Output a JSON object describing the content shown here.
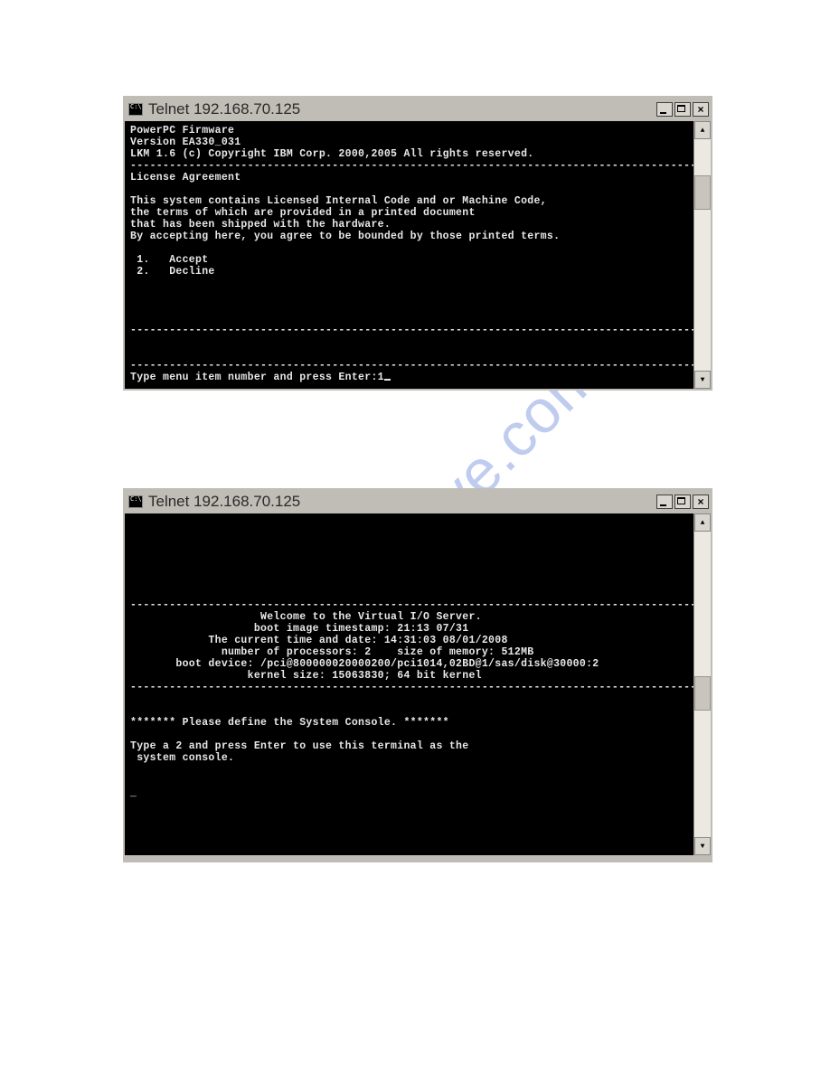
{
  "watermark": "manualshive.com",
  "window1": {
    "title": "Telnet 192.168.70.125",
    "icon_label": "C:\\",
    "lines": {
      "l0": "PowerPC Firmware",
      "l1": "Version EA330_031",
      "l2": "LKM 1.6 (c) Copyright IBM Corp. 2000,2005 All rights reserved.",
      "hr1": "-------------------------------------------------------------------------------------------------",
      "l3": "License Agreement",
      "blank1": "",
      "l4": "This system contains Licensed Internal Code and or Machine Code,",
      "l5": "the terms of which are provided in a printed document",
      "l6": "that has been shipped with the hardware.",
      "l7": "By accepting here, you agree to be bounded by those printed terms.",
      "blank2": "",
      "opt1": " 1.   Accept",
      "opt2": " 2.   Decline",
      "blank3": "",
      "blank4": "",
      "blank5": "",
      "blank6": "",
      "hr2": "-------------------------------------------------------------------------------------------------",
      "blank7": "",
      "blank8": "",
      "hr3": "-------------------------------------------------------------------------------------------------",
      "prompt": "Type menu item number and press Enter:1"
    }
  },
  "window2": {
    "title": "Telnet 192.168.70.125",
    "icon_label": "C:\\",
    "lines": {
      "blank_top": "\n\n\n\n\n\n",
      "hr1": "-------------------------------------------------------------------------------------------------",
      "c1": "                    Welcome to the Virtual I/O Server.",
      "c2": "                   boot image timestamp: 21:13 07/31",
      "c3": "            The current time and date: 14:31:03 08/01/2008",
      "c4": "              number of processors: 2    size of memory: 512MB",
      "c5": "       boot device: /pci@800000020000200/pci1014,02BD@1/sas/disk@30000:2",
      "c6": "                  kernel size: 15063830; 64 bit kernel",
      "hr2": "-------------------------------------------------------------------------------------------------",
      "blank1": "",
      "blank2": "",
      "p1": "******* Please define the System Console. *******",
      "blank3": "",
      "p2": "Type a 2 and press Enter to use this terminal as the",
      "p3": " system console.",
      "blank4": "",
      "blank5": "",
      "cursor_line": "_"
    }
  }
}
